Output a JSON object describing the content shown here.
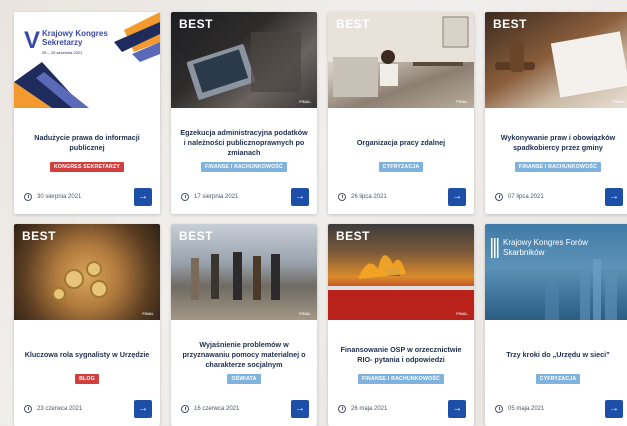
{
  "colors": {
    "accent_button": "#1e4fa8",
    "tag_red": "#d1403f",
    "tag_blue": "#7fb3dd"
  },
  "cards": [
    {
      "badge": "",
      "title": "Nadużycie prawa do informacji publicznej",
      "tag": "KONGRES SEKRETARZY",
      "tag_color": "#d1403f",
      "date": "30 sierpnia 2021",
      "thumb": {
        "heading": "Krajowy Kongres Sekretarzy",
        "subheading": "28 – 29 września 2021"
      }
    },
    {
      "badge": "BEST",
      "title": "Egzekucja administracyjna podatków i należności publicznoprawnych po zmianach",
      "tag": "FINANSE I RACHUNKOWOŚĆ",
      "tag_color": "#7fb3dd",
      "date": "17 sierpnia 2021"
    },
    {
      "badge": "BEST",
      "title": "Organizacja pracy zdalnej",
      "tag": "CYFRYZACJA",
      "tag_color": "#7fb3dd",
      "date": "26 lipca 2021"
    },
    {
      "badge": "BEST",
      "title": "Wykonywanie praw i obowiązków spadkobiercy przez gminy",
      "tag": "FINANSE I RACHUNKOWOŚĆ",
      "tag_color": "#7fb3dd",
      "date": "07 lipca 2021"
    },
    {
      "badge": "BEST",
      "title": "Kluczowa rola sygnalisty w Urzędzie",
      "tag": "BLOG",
      "tag_color": "#d1403f",
      "date": "23 czerwca 2021"
    },
    {
      "badge": "BEST",
      "title": "Wyjaśnienie problemów w przyznawaniu pomocy materialnej o charakterze socjalnym",
      "tag": "OŚWIATA",
      "tag_color": "#7fb3dd",
      "date": "16 czerwca 2021"
    },
    {
      "badge": "BEST",
      "title": "Finansowanie OSP w orzecznictwie RIO- pytania i odpowiedzi",
      "tag": "FINANSE I RACHUNKOWOŚĆ",
      "tag_color": "#7fb3dd",
      "date": "26 maja 2021"
    },
    {
      "badge": "",
      "title": "Trzy kroki do „Urzędu w sieci”",
      "tag": "CYFRYZACJA",
      "tag_color": "#7fb3dd",
      "date": "05 maja 2021",
      "thumb": {
        "heading": "Krajowy Kongres Forów Skarbników"
      }
    }
  ]
}
